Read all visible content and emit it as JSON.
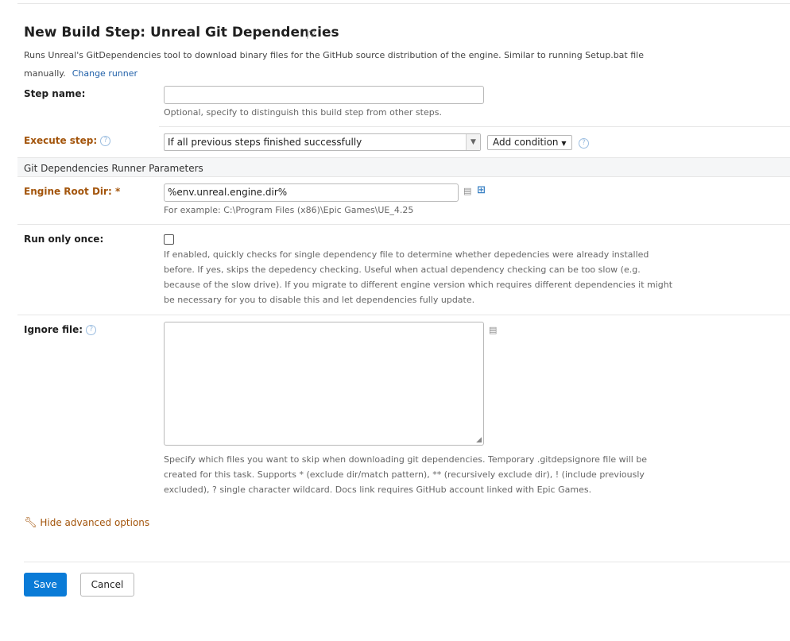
{
  "header": {
    "title": "New Build Step: Unreal Git Dependencies",
    "title_menu_icon": "caret-down",
    "description": "Runs Unreal's GitDependencies tool to download binary files for the GitHub source distribution of the engine. Similar to running Setup.bat file manually.",
    "change_runner": "Change runner"
  },
  "step_name": {
    "label": "Step name:",
    "value": "",
    "note": "Optional, specify to distinguish this build step from other steps."
  },
  "execute_step": {
    "label": "Execute step:",
    "selected": "If all previous steps finished successfully",
    "add_condition": "Add condition"
  },
  "section": {
    "title": "Git Dependencies Runner Parameters"
  },
  "engine_root": {
    "label": "Engine Root Dir:",
    "required_mark": "*",
    "value": "%env.unreal.engine.dir%",
    "note": "For example: C:\\Program Files (x86)\\Epic Games\\UE_4.25"
  },
  "run_once": {
    "label": "Run only once:",
    "checked": false,
    "note": "If enabled, quickly checks for single dependency file to determine whether depedencies were already installed before. If yes, skips the depedency checking. Useful when actual dependency checking can be too slow (e.g. because of the slow drive). If you migrate to different engine version which requires different dependencies it might be necessary for you to disable this and let dependencies fully update."
  },
  "ignore_file": {
    "label": "Ignore file:",
    "value": "",
    "note": "Specify which files you want to skip when downloading git dependencies. Temporary .gitdepsignore file will be created for this task. Supports * (exclude dir/match pattern), ** (recursively exclude dir), ! (include previously excluded), ? single character wildcard. Docs link requires GitHub account linked with Epic Games."
  },
  "advanced": {
    "label": "Hide advanced options",
    "icon": "wrench-icon"
  },
  "footer": {
    "save": "Save",
    "cancel": "Cancel"
  },
  "colors": {
    "accent": "#0a7bd7",
    "label_orange": "#a3550c",
    "link": "#1f5fa8"
  }
}
